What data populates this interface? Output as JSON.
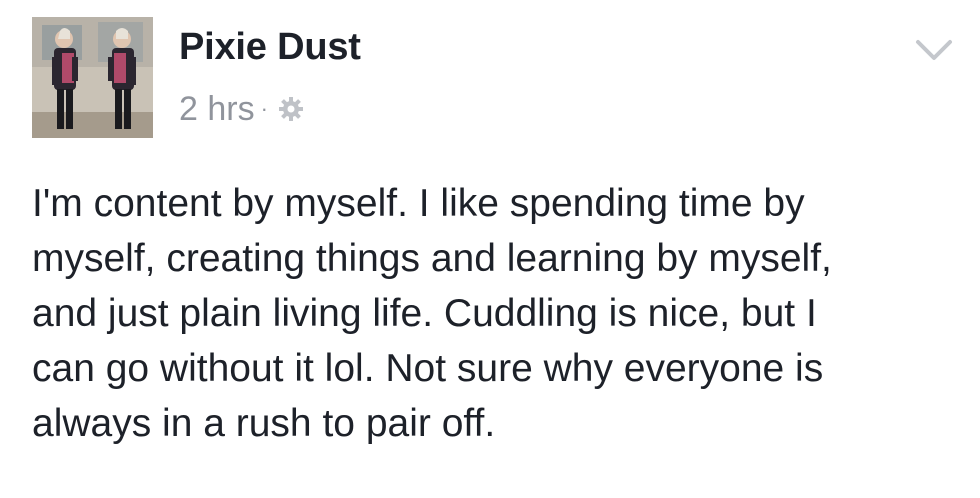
{
  "post": {
    "author": "Pixie Dust",
    "timestamp": "2 hrs",
    "separator": "·",
    "privacy_icon": "gear-icon",
    "menu_icon": "chevron-down-icon",
    "text": "I'm content by myself. I like spending time by\nmyself, creating things and learning by myself,\nand just plain living life. Cuddling is nice, but I\ncan go without it lol. Not sure why everyone is\nalways in a rush to pair off."
  },
  "colors": {
    "name": "#1d2129",
    "meta": "#90949c",
    "body_text": "#1d2129"
  }
}
